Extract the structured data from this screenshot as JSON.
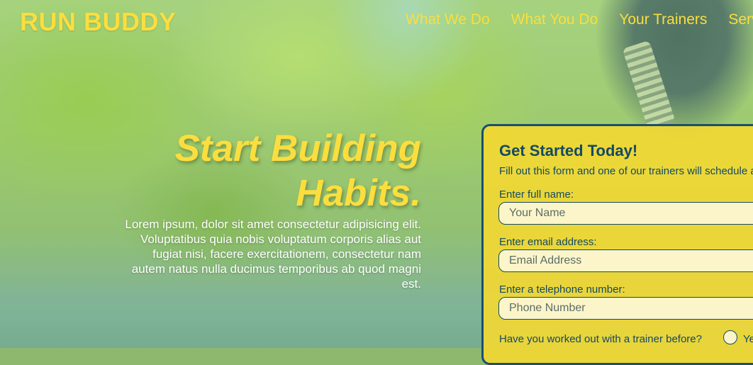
{
  "header": {
    "logo": "RUN BUDDY",
    "nav": [
      "What We Do",
      "What You Do",
      "Your Trainers",
      "Services"
    ]
  },
  "hero": {
    "title_line1": "Start Building",
    "title_line2": "Habits.",
    "body": "Lorem ipsum, dolor sit amet consectetur adipisicing elit. Voluptatibus quia nobis voluptatum corporis alias aut fugiat nisi, facere exercitationem, consectetur nam autem natus nulla ducimus temporibus ab quod magni est."
  },
  "form": {
    "title": "Get Started Today!",
    "intro": "Fill out this form and one of our trainers will schedule a consultation",
    "fields": [
      {
        "label": "Enter full name:",
        "placeholder": "Your Name"
      },
      {
        "label": "Enter email address:",
        "placeholder": "Email Address"
      },
      {
        "label": "Enter a telephone number:",
        "placeholder": "Phone Number"
      }
    ],
    "question": "Have you worked out with a trainer before?",
    "radio_yes": "Yes"
  },
  "colors": {
    "accent": "#fbde3e",
    "form_bg": "#f4d832",
    "form_text": "#144a63"
  }
}
